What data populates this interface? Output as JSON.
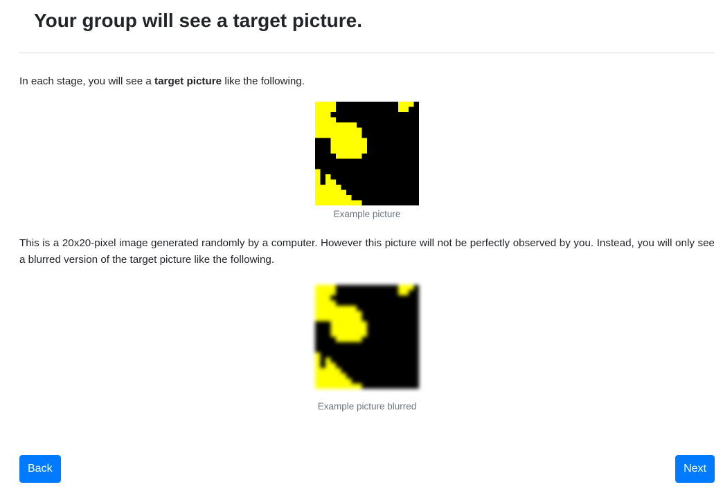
{
  "page": {
    "title": "Your group will see a target picture."
  },
  "intro": {
    "before": "In each stage, you will see a ",
    "bold": "target picture",
    "after": " like the following."
  },
  "figure1": {
    "caption": "Example picture"
  },
  "description": {
    "text": "This is a 20x20-pixel image generated randomly by a computer. However this picture will not be perfectly observed by you. Instead, you will only see a blurred version of the target picture like the following."
  },
  "figure2": {
    "caption": "Example picture blurred"
  },
  "navigation": {
    "back_label": "Back",
    "next_label": "Next"
  },
  "colors": {
    "accent": "#007bff",
    "picture_fill": "#ffff00",
    "picture_ink": "#000000"
  },
  "picture": {
    "rows": [
      "11110000000000001110",
      "11110000000000001100",
      "11100000000000000000",
      "11110000000000000000",
      "11111111000000000000",
      "11111111100000000000",
      "11111111100000000000",
      "00011111110000000000",
      "00011111110000000000",
      "00011111110000000000",
      "00001111100000000000",
      "00000000000000000000",
      "00000000000000000000",
      "10000000000000000000",
      "10100000000000000000",
      "10110000000000000000",
      "11111000000000000000",
      "11111100000000000000",
      "11111110000000000000",
      "11111111100000000000"
    ]
  }
}
